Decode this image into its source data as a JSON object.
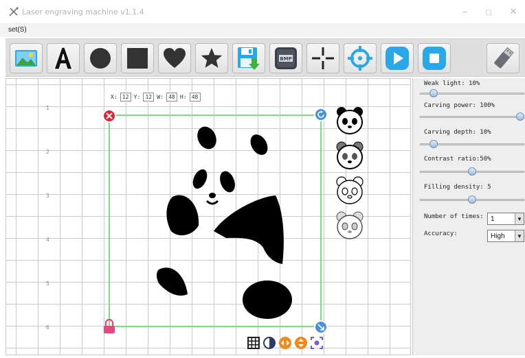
{
  "window": {
    "title": "Laser engraving machine v1.1.4",
    "minimize_glyph": "−",
    "maximize_glyph": "□",
    "close_glyph": "✕"
  },
  "menu": {
    "items": [
      {
        "label": "set(S)"
      }
    ]
  },
  "toolbar": {
    "buttons": [
      {
        "name": "open-image-button",
        "icon": "image-icon"
      },
      {
        "name": "text-button",
        "icon": "letter-a-icon"
      },
      {
        "name": "circle-shape-button",
        "icon": "circle-icon"
      },
      {
        "name": "square-shape-button",
        "icon": "square-icon"
      },
      {
        "name": "heart-shape-button",
        "icon": "heart-icon"
      },
      {
        "name": "star-shape-button",
        "icon": "star-icon"
      },
      {
        "name": "save-button",
        "icon": "save-download-icon"
      },
      {
        "name": "bmp-button",
        "icon": "bmp-icon",
        "label": "BMP"
      },
      {
        "name": "crosshair-button",
        "icon": "crosshair-icon"
      },
      {
        "name": "target-button",
        "icon": "target-icon"
      },
      {
        "name": "play-button",
        "icon": "play-icon"
      },
      {
        "name": "stop-button",
        "icon": "stop-icon"
      },
      {
        "name": "usb-connect-button",
        "icon": "usb-icon"
      }
    ]
  },
  "canvas": {
    "ruler_numbers": [
      "1",
      "2",
      "3",
      "4",
      "5",
      "6"
    ],
    "coords": {
      "x_label": "X:",
      "x_value": "12",
      "y_label": "Y:",
      "y_value": "12",
      "w_label": "W:",
      "w_value": "48",
      "h_label": "H:",
      "h_value": "48"
    },
    "handles": {
      "delete": "delete-handle",
      "rotate": "rotate-handle",
      "lock": "lock-handle",
      "resize": "resize-handle"
    },
    "thumbnails": [
      "panda-thumb-bw",
      "panda-thumb-outline",
      "panda-thumb-sketch",
      "panda-thumb-light"
    ],
    "bottom_tools": [
      "grid-icon",
      "contrast-icon",
      "flip-horizontal-icon",
      "flip-vertical-icon",
      "center-icon"
    ]
  },
  "settings": {
    "weak_light": {
      "label": "Weak light: 10%",
      "value": 0.1
    },
    "carving_power": {
      "label": "Carving power: 100%",
      "value": 1.0
    },
    "carving_depth": {
      "label": "Carving depth: 10%",
      "value": 0.1
    },
    "contrast_ratio": {
      "label": "Contrast ratio:50%",
      "value": 0.5
    },
    "filling_density": {
      "label": "Filling density: 5",
      "value": 0.5
    },
    "number_of_times": {
      "label": "Number of times:",
      "value": "1"
    },
    "accuracy": {
      "label": "Accuracy:",
      "value": "High"
    }
  },
  "colors": {
    "selection": "#7dde7d",
    "delete_handle": "#e0242f",
    "rotate_handle": "#4a90d9",
    "lock_handle": "#e8477a",
    "accent_blue": "#2aa7e6"
  }
}
